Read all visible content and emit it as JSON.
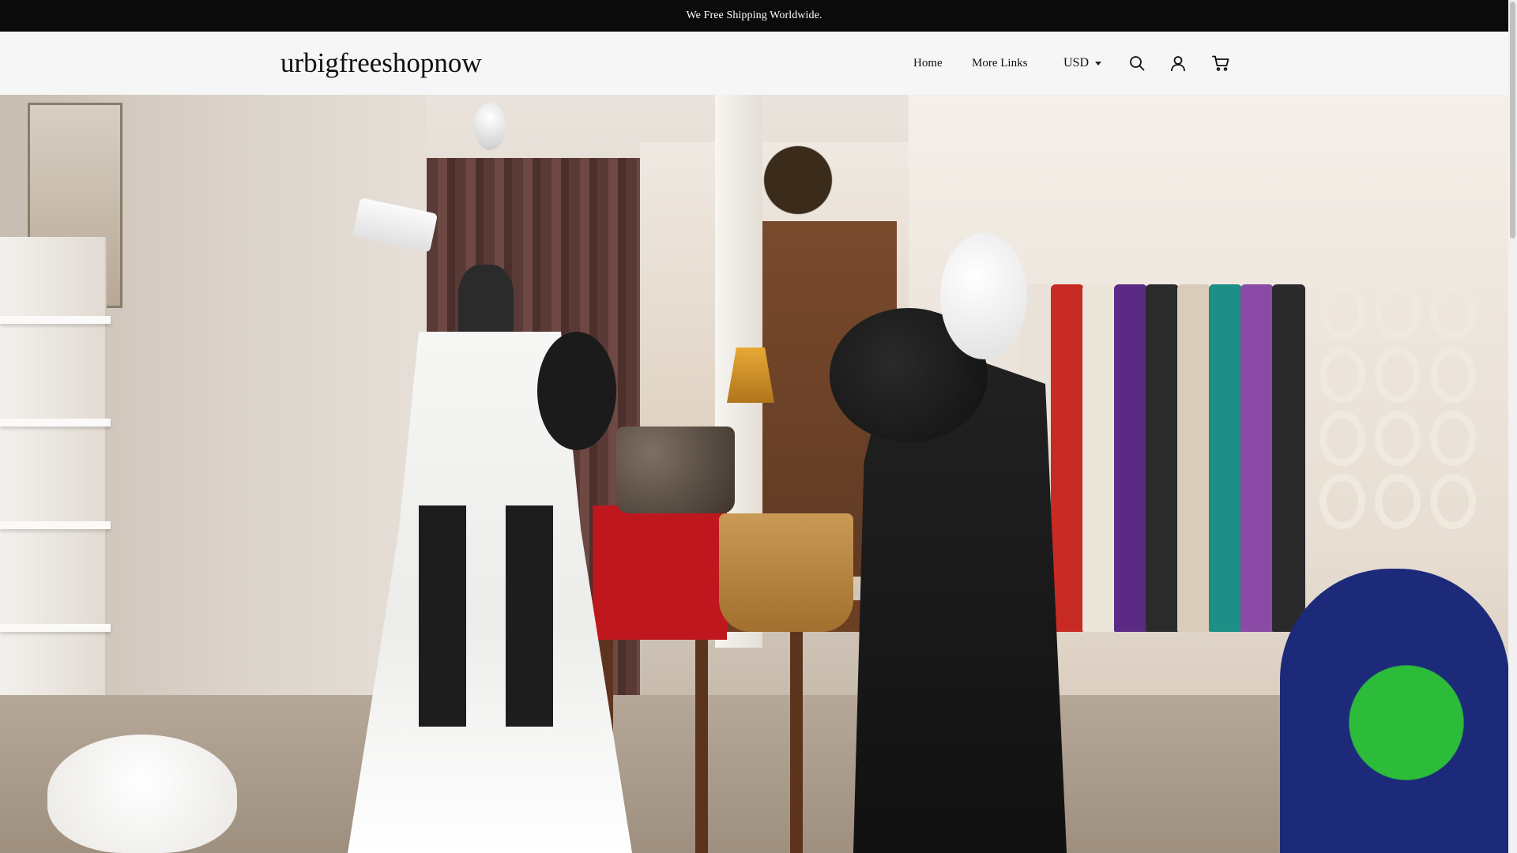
{
  "announcement": {
    "text": "We Free Shipping Worldwide."
  },
  "header": {
    "logo": "urbigfreeshopnow",
    "nav": [
      {
        "label": "Home"
      },
      {
        "label": "More Links"
      }
    ],
    "currency": "USD",
    "icons": {
      "search": "search-icon",
      "account": "account-icon",
      "cart": "cart-icon"
    }
  },
  "hero": {
    "image": "vintage-clothing-store-interior"
  },
  "colors": {
    "announcement_bg": "#0b0b0b",
    "header_bg": "#f6f6f6",
    "text": "#111111"
  }
}
